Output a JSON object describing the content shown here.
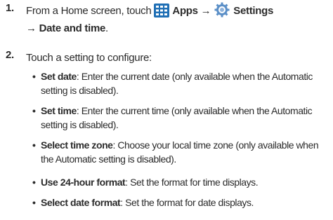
{
  "steps": [
    {
      "number": "1.",
      "prefix": "From a Home screen, touch",
      "apps": "Apps",
      "arrow1": "→",
      "settings": "Settings",
      "arrow2": "→",
      "target": "Date and time",
      "suffix": "."
    },
    {
      "number": "2.",
      "text": "Touch a setting to configure:"
    }
  ],
  "bullets": [
    {
      "term": "Set date",
      "desc": ": Enter the current date (only available when the Automatic setting is disabled)."
    },
    {
      "term": "Set time",
      "desc": ": Enter the current time (only available when the Automatic setting is disabled)."
    },
    {
      "term": "Select time zone",
      "desc": ": Choose your local time zone (only available when the Automatic setting is disabled)."
    },
    {
      "term": "Use 24-hour format",
      "desc": ": Set the format for time displays."
    },
    {
      "term": "Select date format",
      "desc": ": Set the format for date displays."
    }
  ],
  "icons": {
    "apps": "apps-grid-icon",
    "settings": "settings-gear-icon"
  },
  "colors": {
    "text": "#2b2b2b",
    "apps_icon": "#1f6fb5",
    "settings_icon": "#5b8fc7"
  }
}
